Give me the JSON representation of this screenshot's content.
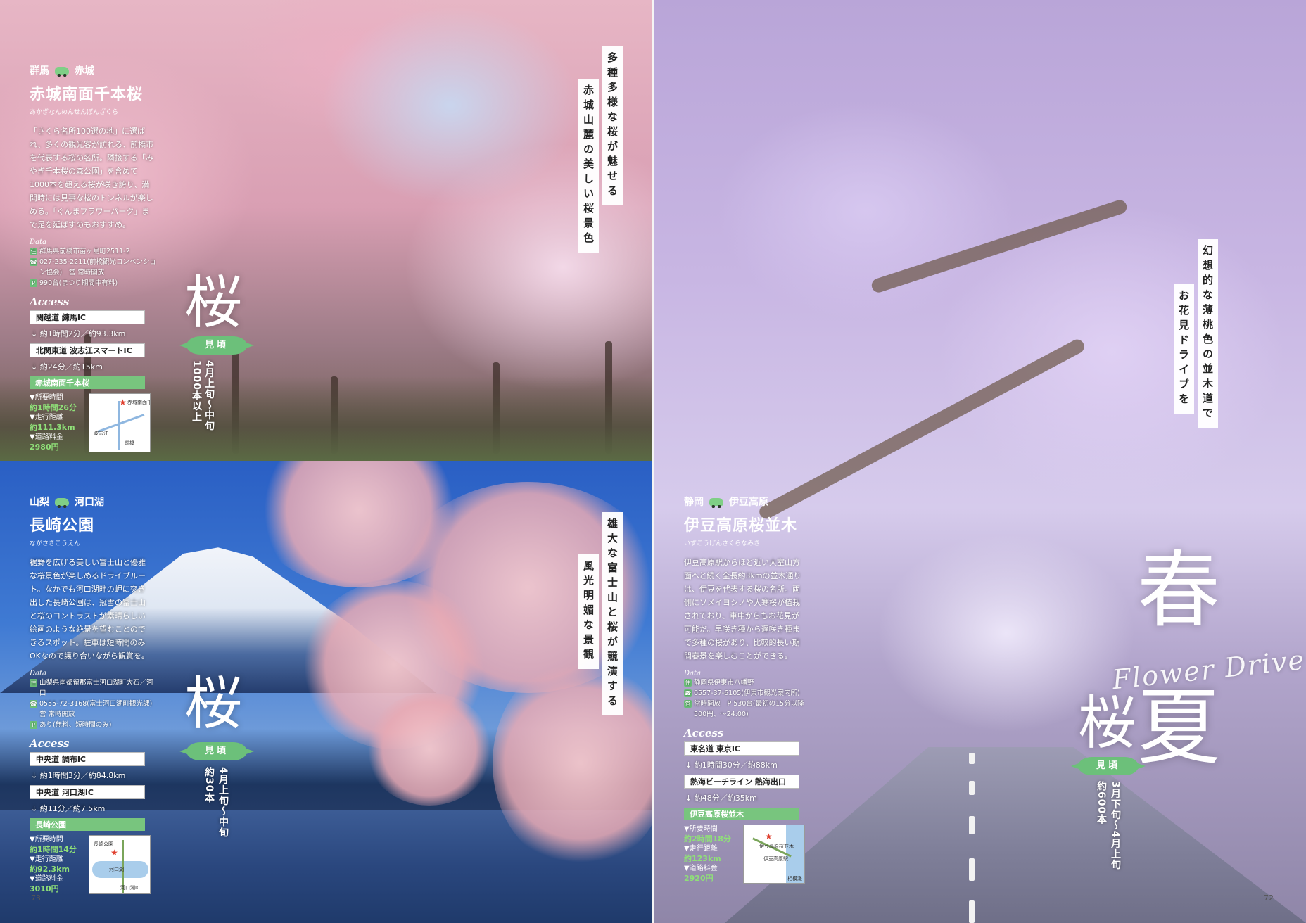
{
  "catch": {
    "akagi_col1": "多種多様な桜が魅せる",
    "akagi_col2": "赤城山麓の美しい桜景色",
    "fuji_col1": "雄大な富士山と桜が競演する",
    "fuji_col2": "風光明媚な景観",
    "izu_col1": "幻想的な薄桃色の並木道で",
    "izu_col2": "お花見ドライブを"
  },
  "spreads": {
    "akagi": {
      "pref": "群馬",
      "area": "赤城",
      "title": "赤城南面千本桜",
      "reading": "あかぎなんめんせんぼんざくら",
      "description": "「さくら名所100選の地」に選ばれ、多くの観光客が訪れる、前橋市を代表する桜の名所。隣接する「みやぎ千本桜の森公園」を含めて1000本を超える桜が咲き誇り、満開時には見事な桜のトンネルが楽しめる。「ぐんまフラワーパーク」まで足を延ばすのもおすすめ。",
      "data_label": "Data",
      "data": [
        {
          "icon": "住",
          "text": "群馬県前橋市苗ヶ島町2511-2"
        },
        {
          "icon": "☎",
          "text": "027-235-2211(前橋観光コンベンション協会)　営 常時開放"
        },
        {
          "icon": "P",
          "text": "990台(まつり期間中有料)"
        }
      ],
      "access_label": "Access",
      "route": [
        {
          "kind": "start",
          "label": "関越道 練馬IC"
        },
        {
          "kind": "leg",
          "label": "約1時間2分／約93.3km"
        },
        {
          "kind": "start",
          "label": "北関東道 波志江スマートIC"
        },
        {
          "kind": "leg",
          "label": "約24分／約15km"
        },
        {
          "kind": "goal",
          "label": "赤城南面千本桜"
        }
      ],
      "summary": [
        {
          "label": "▼所要時間",
          "value": "約1時間26分"
        },
        {
          "label": "▼走行距離",
          "value": "約111.3km"
        },
        {
          "label": "▼道路料金",
          "value": "2980円"
        }
      ],
      "map_labels": [
        "赤城南面千本桜",
        "波志江",
        "前橋"
      ],
      "big": "桜",
      "season_label": "見頃",
      "season_text": "4月上旬～中旬",
      "count_text": "1000本以上"
    },
    "fuji": {
      "pref": "山梨",
      "area": "河口湖",
      "title": "長崎公園",
      "reading": "ながさきこうえん",
      "description": "裾野を広げる美しい富士山と優雅な桜景色が楽しめるドライブルート。なかでも河口湖畔の岬に突き出した長崎公園は、冠雪の富士山と桜のコントラストが素晴らしい絵画のような絶景を望むことのできるスポット。駐車は短時間のみOKなので譲り合いながら観賞を。",
      "data_label": "Data",
      "data": [
        {
          "icon": "住",
          "text": "山梨県南都留郡富士河口湖町大石／河口"
        },
        {
          "icon": "☎",
          "text": "0555-72-3168(富士河口湖町観光課)　営 常時開放"
        },
        {
          "icon": "P",
          "text": "あり(無料、短時間のみ)"
        }
      ],
      "access_label": "Access",
      "route": [
        {
          "kind": "start",
          "label": "中央道 調布IC"
        },
        {
          "kind": "leg",
          "label": "約1時間3分／約84.8km"
        },
        {
          "kind": "start",
          "label": "中央道 河口湖IC"
        },
        {
          "kind": "leg",
          "label": "約11分／約7.5km"
        },
        {
          "kind": "goal",
          "label": "長崎公園"
        }
      ],
      "summary": [
        {
          "label": "▼所要時間",
          "value": "約1時間14分"
        },
        {
          "label": "▼走行距離",
          "value": "約92.3km"
        },
        {
          "label": "▼道路料金",
          "value": "3010円"
        }
      ],
      "map_labels": [
        "長崎公園",
        "河口湖",
        "河口湖IC"
      ],
      "big": "桜",
      "season_label": "見頃",
      "season_text": "4月上旬～中旬",
      "count_text": "約30本"
    },
    "izu": {
      "pref": "静岡",
      "area": "伊豆高原",
      "title": "伊豆高原桜並木",
      "reading": "いずこうげんさくらなみき",
      "description": "伊豆高原駅からほど近い大室山方面へと続く全長約3kmの並木通りは、伊豆を代表する桜の名所。両側にソメイヨシノや大寒桜が植栽されており、車中からもお花見が可能だ。早咲き種から遅咲き種まで多種の桜があり、比較的長い期間春景を楽しむことができる。",
      "data_label": "Data",
      "data": [
        {
          "icon": "住",
          "text": "静岡県伊東市八幡野"
        },
        {
          "icon": "☎",
          "text": "0557-37-6105(伊東市観光案内所)"
        },
        {
          "icon": "営",
          "text": "常時開放　P 530台(最初の15分以降500円、～24:00)"
        }
      ],
      "access_label": "Access",
      "route": [
        {
          "kind": "start",
          "label": "東名道 東京IC"
        },
        {
          "kind": "leg",
          "label": "約1時間30分／約88km"
        },
        {
          "kind": "start",
          "label": "熱海ビーチライン 熱海出口"
        },
        {
          "kind": "leg",
          "label": "約48分／約35km"
        },
        {
          "kind": "goal",
          "label": "伊豆高原桜並木"
        }
      ],
      "summary": [
        {
          "label": "▼所要時間",
          "value": "約2時間18分"
        },
        {
          "label": "▼走行距離",
          "value": "約123km"
        },
        {
          "label": "▼道路料金",
          "value": "2920円"
        }
      ],
      "map_labels": [
        "伊豆高原桜並木",
        "伊豆高原駅",
        "相模灘"
      ],
      "big": "桜",
      "season_label": "見頃",
      "season_text": "3月下旬～4月上旬",
      "count_text": "約600本"
    }
  },
  "feature": {
    "kanji_1": "春",
    "kanji_2": "夏",
    "script": "Flower Drive"
  },
  "pages": {
    "left": "73",
    "right": "72"
  }
}
